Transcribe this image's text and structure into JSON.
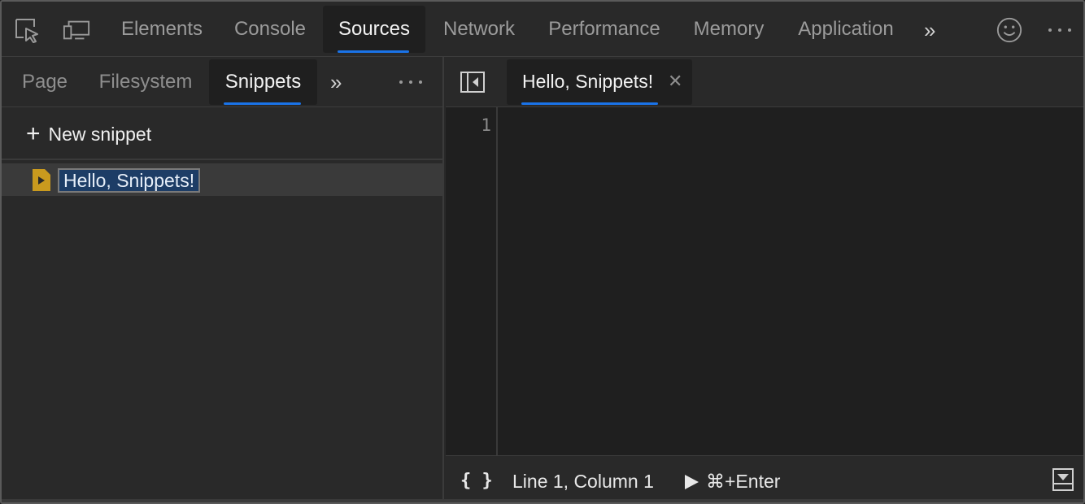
{
  "toolbar": {
    "tabs": [
      {
        "label": "Elements"
      },
      {
        "label": "Console"
      },
      {
        "label": "Sources",
        "active": true
      },
      {
        "label": "Network"
      },
      {
        "label": "Performance"
      },
      {
        "label": "Memory"
      },
      {
        "label": "Application"
      }
    ],
    "more_tabs_icon": "double-chevron-right",
    "icons": [
      "inspect-element-icon",
      "device-toolbar-icon",
      "feedback-smiley-icon",
      "more-menu-icon"
    ]
  },
  "navigator": {
    "tabs": [
      {
        "label": "Page"
      },
      {
        "label": "Filesystem"
      },
      {
        "label": "Snippets",
        "active": true
      }
    ],
    "new_snippet_label": "New snippet",
    "snippets": [
      {
        "name": "Hello, Snippets!",
        "selected": true,
        "renaming": true
      }
    ]
  },
  "editor": {
    "open_tab": "Hello, Snippets!",
    "line_numbers": [
      "1"
    ],
    "status": {
      "pretty_print": "{ }",
      "cursor": "Line 1, Column 1",
      "run_hint": "⌘+Enter"
    }
  },
  "colors": {
    "accent": "#1a73e8",
    "selection": "#1d3d66",
    "snippet_icon": "#c99a1e"
  }
}
